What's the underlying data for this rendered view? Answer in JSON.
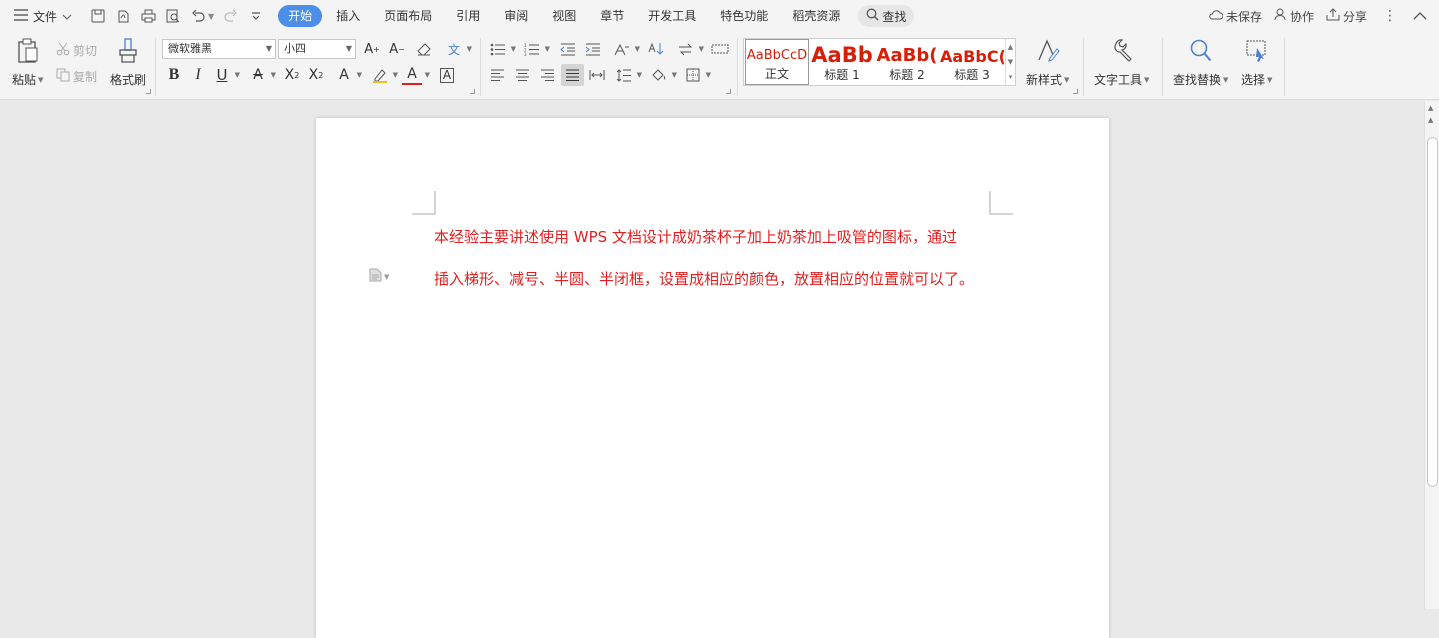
{
  "topbar": {
    "menu_label": "文件",
    "tabs": [
      {
        "label": "开始",
        "active": true
      },
      {
        "label": "插入"
      },
      {
        "label": "页面布局"
      },
      {
        "label": "引用"
      },
      {
        "label": "审阅"
      },
      {
        "label": "视图"
      },
      {
        "label": "章节"
      },
      {
        "label": "开发工具"
      },
      {
        "label": "特色功能"
      },
      {
        "label": "稻壳资源"
      }
    ],
    "search_label": "查找",
    "save_status": "未保存",
    "collab_label": "协作",
    "share_label": "分享",
    "accent_color": "#4c8ee8"
  },
  "ribbon": {
    "paste_label": "粘贴",
    "cut_label": "剪切",
    "copy_label": "复制",
    "format_painter_label": "格式刷",
    "font_name": "微软雅黑",
    "font_size": "小四",
    "styles": [
      {
        "sample": "AaBbCcD",
        "name": "正文"
      },
      {
        "sample": "AaBb",
        "name": "标题 1"
      },
      {
        "sample": "AaBb(",
        "name": "标题 2"
      },
      {
        "sample": "AaBbC(",
        "name": "标题 3"
      }
    ],
    "new_style_label": "新样式",
    "text_tools_label": "文字工具",
    "find_replace_label": "查找替换",
    "select_label": "选择"
  },
  "document": {
    "line1": "本经验主要讲述使用 WPS 文档设计成奶茶杯子加上奶茶加上吸管的图标，通过",
    "line2": "插入梯形、减号、半圆、半闭框，设置成相应的颜色，放置相应的位置就可以了。",
    "text_color": "#e02020"
  }
}
